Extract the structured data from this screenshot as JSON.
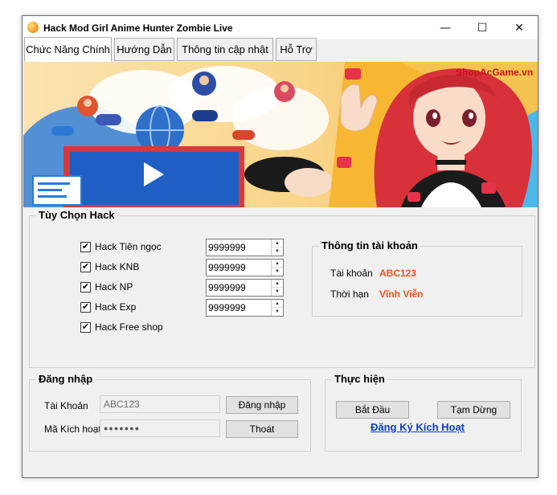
{
  "window": {
    "title": "Hack Mod Girl Anime Hunter Zombie Live",
    "minimize": "—",
    "maximize": "☐",
    "close": "✕"
  },
  "tabs": [
    {
      "label": "Chức Năng Chính",
      "active": true
    },
    {
      "label": "Hướng Dẫn",
      "active": false
    },
    {
      "label": "Thông tin cập nhật",
      "active": false
    },
    {
      "label": "Hỗ Trợ",
      "active": false
    }
  ],
  "banner": {
    "watermark": "ShopAcGame.vn"
  },
  "hack_options": {
    "title": "Tùy Chọn Hack",
    "items": [
      {
        "label": "Hack Tiên ngọc",
        "checked": true,
        "value": "9999999"
      },
      {
        "label": "Hack KNB",
        "checked": true,
        "value": "9999999"
      },
      {
        "label": "Hack NP",
        "checked": true,
        "value": "9999999"
      },
      {
        "label": "Hack Exp",
        "checked": true,
        "value": "9999999"
      },
      {
        "label": "Hack Free shop",
        "checked": true
      }
    ]
  },
  "account_info": {
    "title": "Thông tin tài khoản",
    "account_label": "Tài khoản",
    "account_value": "ABC123",
    "duration_label": "Thời hạn",
    "duration_value": "Vĩnh Viễn"
  },
  "login": {
    "title": "Đăng nhập",
    "account_label": "Tài Khoản",
    "account_value": "ABC123",
    "code_label": "Mã Kích hoạt",
    "code_value": "●●●●●●●",
    "login_button": "Đăng nhập",
    "exit_button": "Thoát"
  },
  "execute": {
    "title": "Thực hiện",
    "start_button": "Bắt Đầu",
    "pause_button": "Tạm Dừng",
    "register_link": "Đăng Ký Kích Hoạt"
  },
  "colors": {
    "accent_orange": "#e8541e",
    "link_blue": "#0a3cc8"
  }
}
